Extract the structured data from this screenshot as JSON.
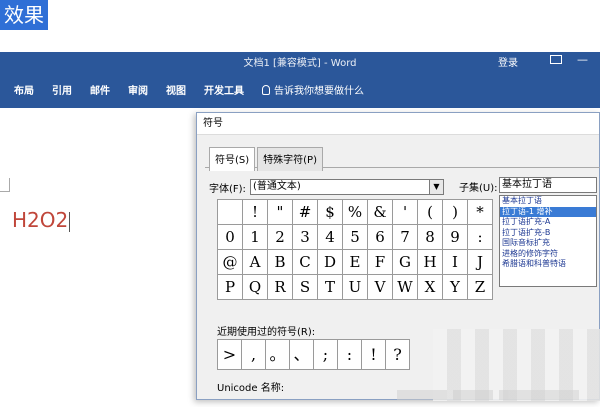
{
  "top_label": "效果",
  "ribbon": {
    "title": "文档1 [兼容模式] - Word",
    "signin": "登录",
    "minimize_glyph": "—",
    "tabs": [
      "布局",
      "引用",
      "邮件",
      "审阅",
      "视图",
      "开发工具"
    ],
    "tell_me": "告诉我你想要做什么"
  },
  "document": {
    "text": "H2O2"
  },
  "dialog": {
    "title": "符号",
    "tabs": [
      "符号(S)",
      "特殊字符(P)"
    ],
    "font_label": "字体(F):",
    "font_value": "(普通文本)",
    "subset_label": "子集(U):",
    "subset_value": "基本拉丁语",
    "subset_options": [
      "基本拉丁语",
      "拉丁语-1 增补",
      "拉丁语扩充-A",
      "拉丁语扩充-B",
      "国际音标扩充",
      "进格的修饰字符",
      "希腊语和科普特语"
    ],
    "subset_selected_index": 1,
    "grid": [
      [
        "",
        "!",
        "\"",
        "#",
        "$",
        "%",
        "&",
        "'",
        "(",
        ")",
        "*"
      ],
      [
        "0",
        "1",
        "2",
        "3",
        "4",
        "5",
        "6",
        "7",
        "8",
        "9",
        ":"
      ],
      [
        "@",
        "A",
        "B",
        "C",
        "D",
        "E",
        "F",
        "G",
        "H",
        "I",
        "J"
      ],
      [
        "P",
        "Q",
        "R",
        "S",
        "T",
        "U",
        "V",
        "W",
        "X",
        "Y",
        "Z"
      ]
    ],
    "grid_extra_row4": [
      "[",
      "\\",
      "]"
    ],
    "recent_label": "近期使用过的符号(R):",
    "recent": [
      ">",
      ",",
      "。",
      "、",
      ";",
      ":",
      "!",
      "?"
    ],
    "unicode_label": "Unicode 名称:"
  }
}
